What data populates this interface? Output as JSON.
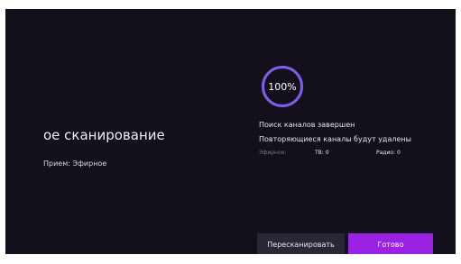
{
  "scan": {
    "title": "ое сканирование",
    "reception": "Прием: Эфирное",
    "progress_label": "100%",
    "progress_fraction": 1.0,
    "status_complete": "Поиск каналов завершен",
    "status_duplicates": "Повторяющиеся каналы будут удалены",
    "source_label": "Эфирное:",
    "tv_count": "ТВ: 0",
    "radio_count": "Радио: 0"
  },
  "buttons": {
    "rescan_label": "Пересканировать",
    "done_label": "Готово"
  },
  "colors": {
    "background": "#13101b",
    "accent": "#9b22e4",
    "ring": "#7e5cf0",
    "secondary_button": "#2a2734"
  }
}
